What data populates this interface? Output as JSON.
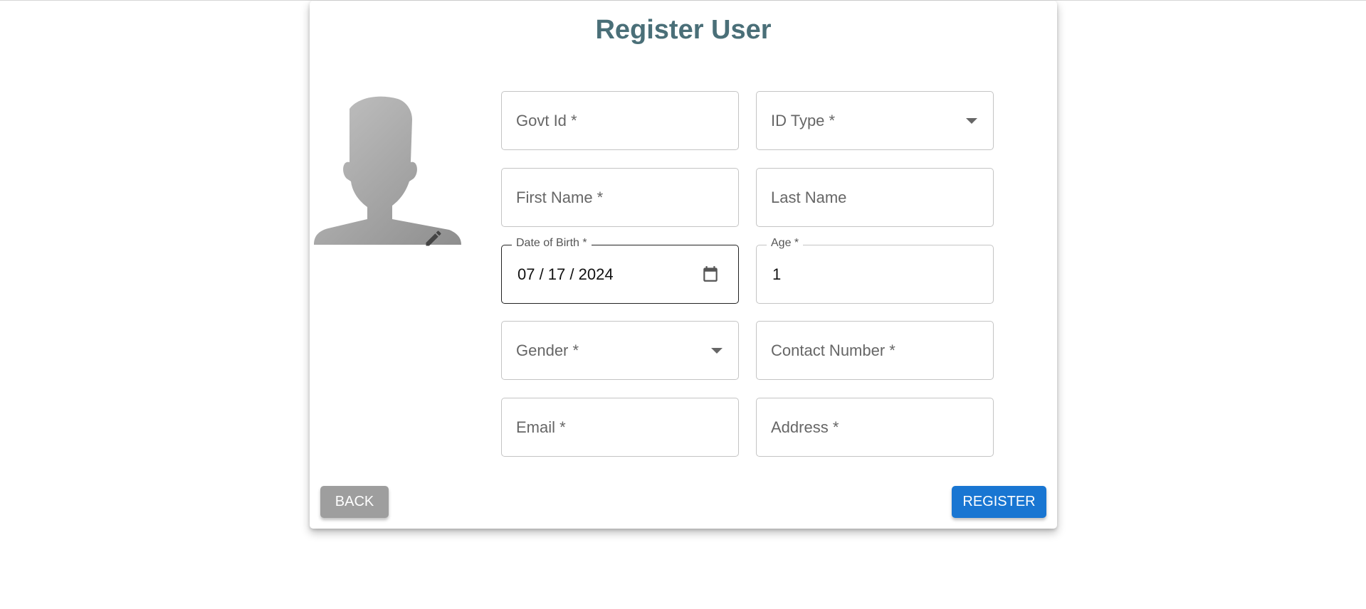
{
  "title": "Register User",
  "fields": {
    "govt_id": {
      "label": "Govt Id *"
    },
    "id_type": {
      "label": "ID Type *"
    },
    "first_name": {
      "label": "First Name *"
    },
    "last_name": {
      "label": "Last Name"
    },
    "dob": {
      "label": "Date of Birth *",
      "value": "07 / 17 / 2024"
    },
    "age": {
      "label": "Age *",
      "value": "1"
    },
    "gender": {
      "label": "Gender *"
    },
    "contact": {
      "label": "Contact Number *"
    },
    "email": {
      "label": "Email *"
    },
    "address": {
      "label": "Address *"
    }
  },
  "buttons": {
    "back": "BACK",
    "register": "REGISTER"
  },
  "colors": {
    "title": "#4a6f78",
    "primary": "#1976d2",
    "back": "#9e9e9e"
  }
}
